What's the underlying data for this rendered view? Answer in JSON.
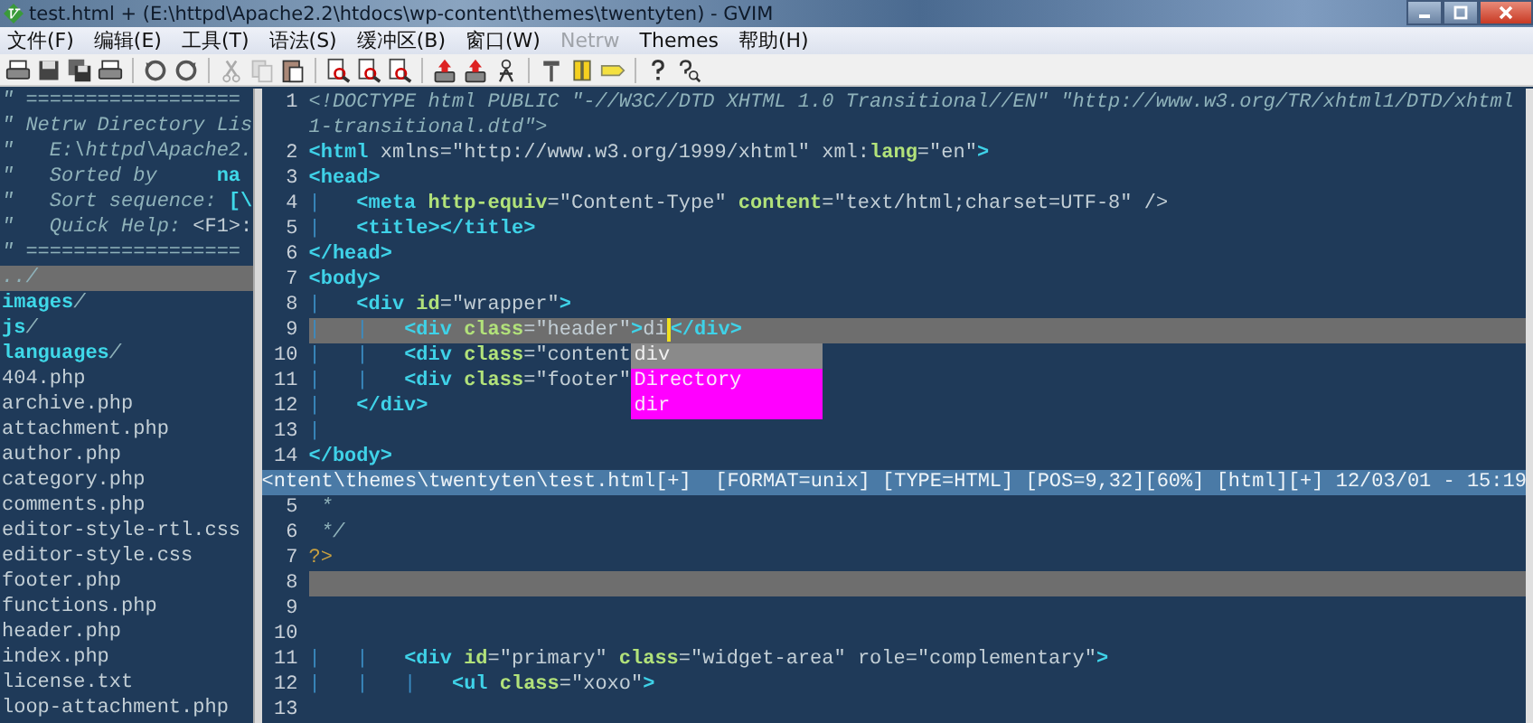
{
  "window": {
    "title": "test.html + (E:\\httpd\\Apache2.2\\htdocs\\wp-content\\themes\\twentyten) - GVIM"
  },
  "menu": [
    {
      "label": "文件(F)",
      "disabled": false
    },
    {
      "label": "编辑(E)",
      "disabled": false
    },
    {
      "label": "工具(T)",
      "disabled": false
    },
    {
      "label": "语法(S)",
      "disabled": false
    },
    {
      "label": "缓冲区(B)",
      "disabled": false
    },
    {
      "label": "窗口(W)",
      "disabled": false
    },
    {
      "label": "Netrw",
      "disabled": true
    },
    {
      "label": "Themes",
      "disabled": false
    },
    {
      "label": "帮助(H)",
      "disabled": false
    }
  ],
  "netrw": {
    "entries": [
      {
        "current": false,
        "segments": [
          {
            "kind": "comment",
            "text": "\" =================="
          }
        ]
      },
      {
        "current": false,
        "segments": [
          {
            "kind": "comment",
            "text": "\" Netrw Directory Lis"
          }
        ]
      },
      {
        "current": false,
        "segments": [
          {
            "kind": "comment",
            "text": "\"   E:\\httpd\\Apache2."
          }
        ]
      },
      {
        "current": false,
        "segments": [
          {
            "kind": "comment",
            "text": "\"   Sorted by     "
          },
          {
            "kind": "key",
            "text": "na"
          }
        ]
      },
      {
        "current": false,
        "segments": [
          {
            "kind": "comment",
            "text": "\"   Sort sequence: "
          },
          {
            "kind": "key",
            "text": "[\\"
          }
        ]
      },
      {
        "current": false,
        "segments": [
          {
            "kind": "comment",
            "text": "\"   Quick Help: "
          },
          {
            "kind": "text",
            "text": "<F1>:"
          }
        ]
      },
      {
        "current": false,
        "segments": [
          {
            "kind": "comment",
            "text": "\" =================="
          }
        ]
      },
      {
        "current": true,
        "segments": [
          {
            "kind": "comment",
            "text": "../"
          }
        ]
      },
      {
        "current": false,
        "segments": [
          {
            "kind": "key",
            "text": "images"
          },
          {
            "kind": "comment",
            "text": "/"
          }
        ]
      },
      {
        "current": false,
        "segments": [
          {
            "kind": "key",
            "text": "js"
          },
          {
            "kind": "comment",
            "text": "/"
          }
        ]
      },
      {
        "current": false,
        "segments": [
          {
            "kind": "key",
            "text": "languages"
          },
          {
            "kind": "comment",
            "text": "/"
          }
        ]
      },
      {
        "current": false,
        "segments": [
          {
            "kind": "text",
            "text": "404.php"
          }
        ]
      },
      {
        "current": false,
        "segments": [
          {
            "kind": "text",
            "text": "archive.php"
          }
        ]
      },
      {
        "current": false,
        "segments": [
          {
            "kind": "text",
            "text": "attachment.php"
          }
        ]
      },
      {
        "current": false,
        "segments": [
          {
            "kind": "text",
            "text": "author.php"
          }
        ]
      },
      {
        "current": false,
        "segments": [
          {
            "kind": "text",
            "text": "category.php"
          }
        ]
      },
      {
        "current": false,
        "segments": [
          {
            "kind": "text",
            "text": "comments.php"
          }
        ]
      },
      {
        "current": false,
        "segments": [
          {
            "kind": "text",
            "text": "editor-style-rtl.css"
          }
        ]
      },
      {
        "current": false,
        "segments": [
          {
            "kind": "text",
            "text": "editor-style.css"
          }
        ]
      },
      {
        "current": false,
        "segments": [
          {
            "kind": "text",
            "text": "footer.php"
          }
        ]
      },
      {
        "current": false,
        "segments": [
          {
            "kind": "text",
            "text": "functions.php"
          }
        ]
      },
      {
        "current": false,
        "segments": [
          {
            "kind": "text",
            "text": "header.php"
          }
        ]
      },
      {
        "current": false,
        "segments": [
          {
            "kind": "text",
            "text": "index.php"
          }
        ]
      },
      {
        "current": false,
        "segments": [
          {
            "kind": "text",
            "text": "license.txt"
          }
        ]
      },
      {
        "current": false,
        "segments": [
          {
            "kind": "text",
            "text": "loop-attachment.php"
          }
        ]
      }
    ]
  },
  "top_window": {
    "lines": [
      {
        "number": "1",
        "cursorline": false,
        "segments": [
          {
            "kind": "comment",
            "text": "<!DOCTYPE html PUBLIC \"-//W3C//DTD XHTML 1.0 Transitional//EN\" \"http://www.w3.org/TR/xhtml1/DTD/xhtml"
          }
        ]
      },
      {
        "cursorline": false,
        "segments": [
          {
            "kind": "comment",
            "text": "1-transitional.dtd\">"
          }
        ]
      },
      {
        "number": "2",
        "cursorline": false,
        "segments": [
          {
            "kind": "tag",
            "text": "<html"
          },
          {
            "kind": "text",
            "text": " xmlns=\"http://www.w3.org/1999/xhtml\" xml:"
          },
          {
            "kind": "attr",
            "text": "lang"
          },
          {
            "kind": "text",
            "text": "=\"en\""
          },
          {
            "kind": "tag",
            "text": ">"
          }
        ]
      },
      {
        "number": "3",
        "cursorline": false,
        "segments": [
          {
            "kind": "tag",
            "text": "<head>"
          }
        ]
      },
      {
        "number": "4",
        "cursorline": false,
        "segments": [
          {
            "kind": "guide",
            "text": "|   "
          },
          {
            "kind": "tag",
            "text": "<meta "
          },
          {
            "kind": "attr",
            "text": "http-equiv"
          },
          {
            "kind": "text",
            "text": "=\"Content-Type\" "
          },
          {
            "kind": "attr",
            "text": "content"
          },
          {
            "kind": "text",
            "text": "=\"text/html;charset=UTF-8\" />"
          }
        ]
      },
      {
        "number": "5",
        "cursorline": false,
        "segments": [
          {
            "kind": "guide",
            "text": "|   "
          },
          {
            "kind": "tag",
            "text": "<title></title>"
          }
        ]
      },
      {
        "number": "6",
        "cursorline": false,
        "segments": [
          {
            "kind": "tag",
            "text": "</head>"
          }
        ]
      },
      {
        "number": "7",
        "cursorline": false,
        "segments": [
          {
            "kind": "tag",
            "text": "<body>"
          }
        ]
      },
      {
        "number": "8",
        "cursorline": false,
        "segments": [
          {
            "kind": "guide",
            "text": "|   "
          },
          {
            "kind": "tag",
            "text": "<div "
          },
          {
            "kind": "attr",
            "text": "id"
          },
          {
            "kind": "text",
            "text": "=\"wrapper\""
          },
          {
            "kind": "tag",
            "text": ">"
          }
        ]
      },
      {
        "number": "9",
        "cursorline": true,
        "segments": [
          {
            "kind": "guide",
            "text": "|   |   "
          },
          {
            "kind": "tag",
            "text": "<div "
          },
          {
            "kind": "attr",
            "text": "class"
          },
          {
            "kind": "text",
            "text": "=\"header\""
          },
          {
            "kind": "tag",
            "text": ">"
          },
          {
            "kind": "text",
            "text": "di"
          },
          {
            "kind": "cursor"
          },
          {
            "kind": "tag",
            "text": "</div>"
          }
        ]
      },
      {
        "number": "10",
        "cursorline": false,
        "segments": [
          {
            "kind": "guide",
            "text": "|   |   "
          },
          {
            "kind": "tag",
            "text": "<div "
          },
          {
            "kind": "attr",
            "text": "class"
          },
          {
            "kind": "text",
            "text": "=\"content"
          }
        ]
      },
      {
        "number": "11",
        "cursorline": false,
        "segments": [
          {
            "kind": "guide",
            "text": "|   |   "
          },
          {
            "kind": "tag",
            "text": "<div "
          },
          {
            "kind": "attr",
            "text": "class"
          },
          {
            "kind": "text",
            "text": "=\"footer\""
          }
        ]
      },
      {
        "number": "12",
        "cursorline": false,
        "segments": [
          {
            "kind": "guide",
            "text": "|   "
          },
          {
            "kind": "tag",
            "text": "</div>"
          }
        ]
      },
      {
        "number": "13",
        "cursorline": false,
        "segments": [
          {
            "kind": "guide",
            "text": "|"
          }
        ]
      },
      {
        "number": "14",
        "cursorline": false,
        "segments": [
          {
            "kind": "tag",
            "text": "</body>"
          }
        ]
      }
    ],
    "completion": [
      {
        "label": "div",
        "selected": true
      },
      {
        "label": "Directory",
        "selected": false
      },
      {
        "label": "dir",
        "selected": false
      }
    ],
    "status_line": "<ntent\\themes\\twentyten\\test.html[+]  [FORMAT=unix] [TYPE=HTML] [POS=9,32][60%] [html][+] 12/03/01 - 15:19"
  },
  "bottom_window": {
    "lines": [
      {
        "number": "5",
        "cursorline": false,
        "segments": [
          {
            "kind": "comment",
            "text": " *"
          }
        ]
      },
      {
        "number": "6",
        "cursorline": false,
        "segments": [
          {
            "kind": "comment",
            "text": " */"
          }
        ]
      },
      {
        "number": "7",
        "cursorline": false,
        "segments": [
          {
            "kind": "php",
            "text": "?>"
          }
        ]
      },
      {
        "number": "8",
        "cursorline": true
      },
      {
        "number": "9",
        "cursorline": false
      },
      {
        "number": "10",
        "cursorline": false
      },
      {
        "number": "11",
        "cursorline": false,
        "segments": [
          {
            "kind": "guide",
            "text": "|   |   "
          },
          {
            "kind": "tag",
            "text": "<div "
          },
          {
            "kind": "attr",
            "text": "id"
          },
          {
            "kind": "text",
            "text": "=\"primary\" "
          },
          {
            "kind": "attr",
            "text": "class"
          },
          {
            "kind": "text",
            "text": "=\"widget-area\" role=\"complementary\""
          },
          {
            "kind": "tag",
            "text": ">"
          }
        ]
      },
      {
        "number": "12",
        "cursorline": false,
        "segments": [
          {
            "kind": "guide",
            "text": "|   |   |   "
          },
          {
            "kind": "tag",
            "text": "<ul "
          },
          {
            "kind": "attr",
            "text": "class"
          },
          {
            "kind": "text",
            "text": "=\"xoxo\""
          },
          {
            "kind": "tag",
            "text": ">"
          }
        ]
      },
      {
        "number": "13",
        "cursorline": false
      }
    ]
  }
}
